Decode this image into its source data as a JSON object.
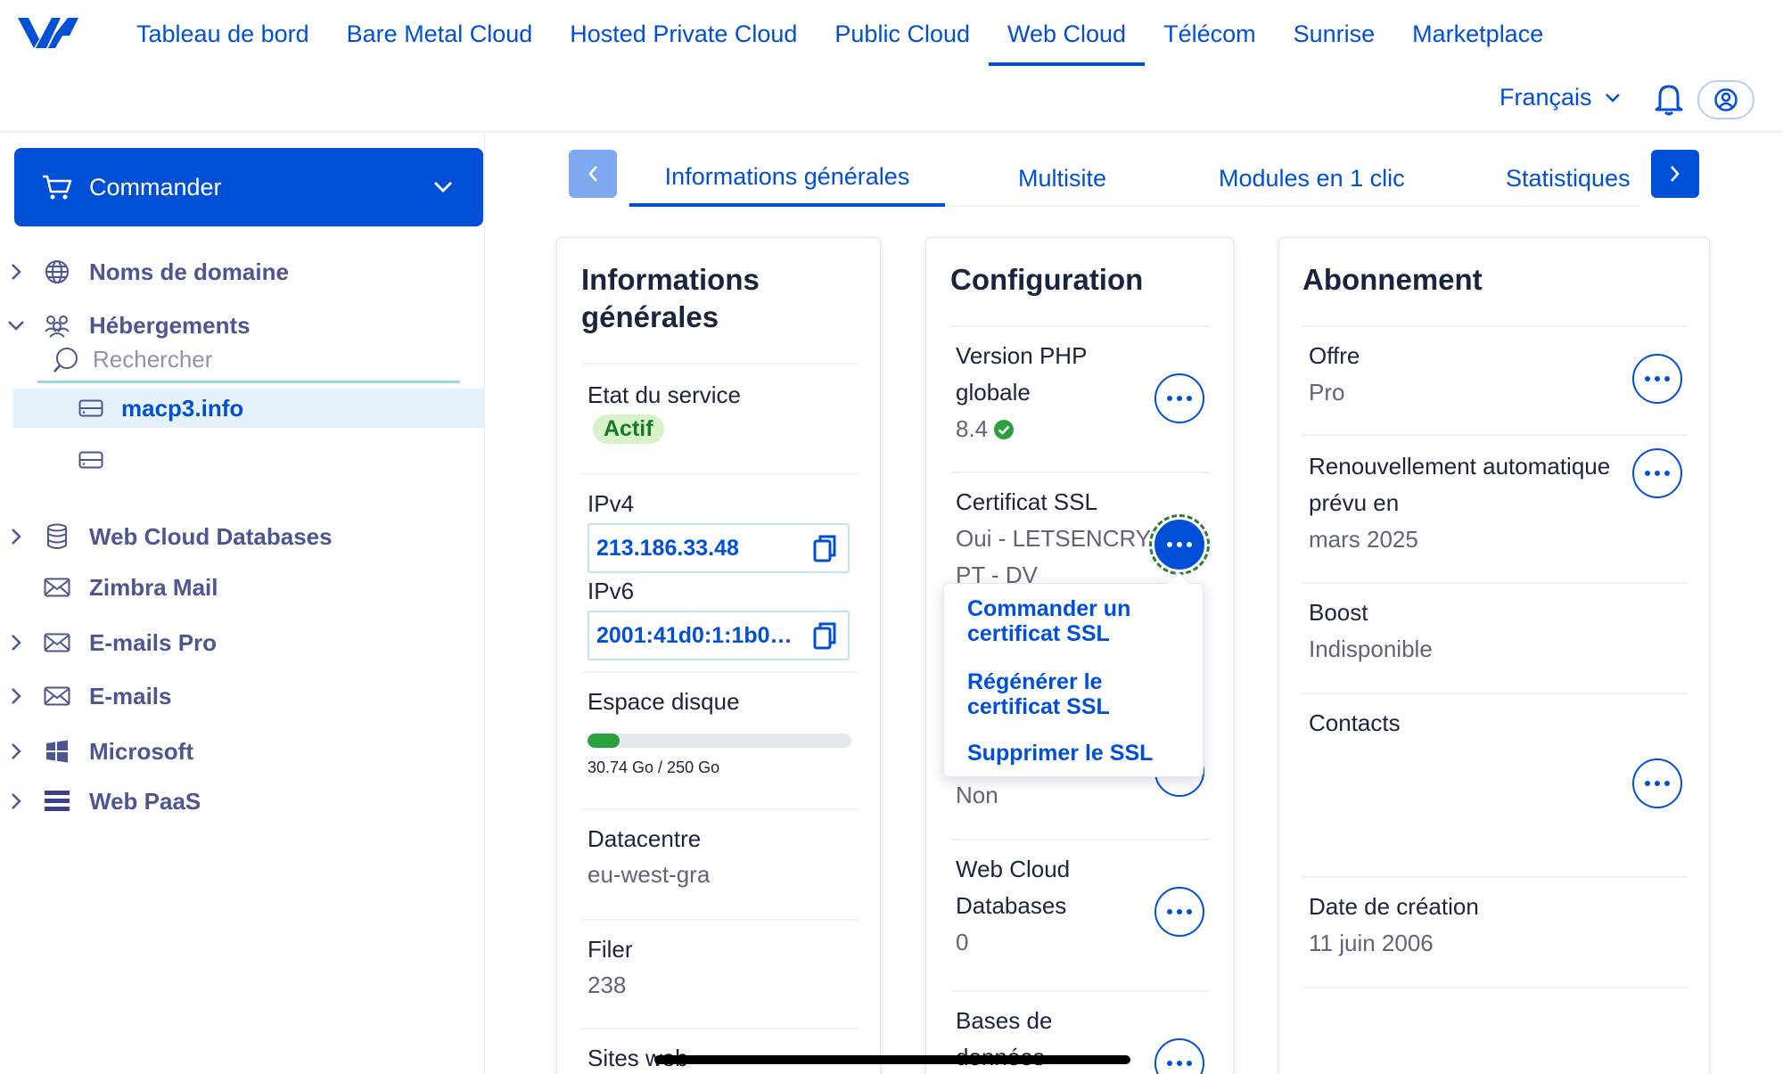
{
  "topnav": {
    "items": [
      {
        "label": "Tableau de bord"
      },
      {
        "label": "Bare Metal Cloud"
      },
      {
        "label": "Hosted Private Cloud"
      },
      {
        "label": "Public Cloud"
      },
      {
        "label": "Web Cloud",
        "active": true
      },
      {
        "label": "Télécom"
      },
      {
        "label": "Sunrise"
      },
      {
        "label": "Marketplace"
      }
    ],
    "language": "Français"
  },
  "sidebar": {
    "order_label": "Commander",
    "items": [
      {
        "label": "Noms de domaine",
        "icon": "globe-icon"
      },
      {
        "label": "Hébergements",
        "icon": "hosting-icon",
        "expanded": true
      },
      {
        "label": "Web Cloud Databases",
        "icon": "database-icon"
      },
      {
        "label": "Zimbra Mail",
        "icon": "mail-icon"
      },
      {
        "label": "E-mails Pro",
        "icon": "mail-icon"
      },
      {
        "label": "E-mails",
        "icon": "mail-icon"
      },
      {
        "label": "Microsoft",
        "icon": "windows-icon"
      },
      {
        "label": "Web PaaS",
        "icon": "paas-icon"
      }
    ],
    "search_placeholder": "Rechercher",
    "hostings": [
      {
        "label": "macp3.info",
        "active": true
      },
      {
        "label": ""
      }
    ]
  },
  "tabs": {
    "items": [
      {
        "label": "Informations générales",
        "active": true
      },
      {
        "label": "Multisite"
      },
      {
        "label": "Modules en 1 clic"
      },
      {
        "label": "Statistiques"
      }
    ]
  },
  "general": {
    "title": "Informations générales",
    "service_label": "Etat du service",
    "service_status": "Actif",
    "ipv4_label": "IPv4",
    "ipv4_value": "213.186.33.48",
    "ipv6_label": "IPv6",
    "ipv6_value": "2001:41d0:1:1b0…",
    "disk_label": "Espace disque",
    "disk_usage": "30.74 Go / 250 Go",
    "disk_used_fraction": 0.123,
    "datacentre_label": "Datacentre",
    "datacentre_value": "eu-west-gra",
    "filer_label": "Filer",
    "filer_value": "238",
    "sites_label": "Sites web"
  },
  "config": {
    "title": "Configuration",
    "php_label_1": "Version PHP",
    "php_label_2": "globale",
    "php_value": "8.4",
    "ssl_label": "Certificat SSL",
    "ssl_value_1": "Oui - LETSENCRY",
    "ssl_value_2": "PT - DV",
    "hidden_value": "Non",
    "wcdb_label_1": "Web Cloud",
    "wcdb_label_2": "Databases",
    "wcdb_value": "0",
    "db_label_1": "Bases de",
    "db_label_2": "données",
    "ssl_menu": {
      "order_1": "Commander un",
      "order_2": "certificat SSL",
      "regen_1": "Régénérer le",
      "regen_2": "certificat SSL",
      "delete": "Supprimer le SSL"
    }
  },
  "subscription": {
    "title": "Abonnement",
    "offer_label": "Offre",
    "offer_value": "Pro",
    "renewal_label_1": "Renouvellement automatique",
    "renewal_label_2": "prévu en",
    "renewal_value": "mars 2025",
    "boost_label": "Boost",
    "boost_value": "Indisponible",
    "contacts_label": "Contacts",
    "creation_label": "Date de création",
    "creation_value": "11 juin 2006"
  },
  "colors": {
    "brand": "#0050d7",
    "active_badge_bg": "#d8f3c9",
    "progress_fill": "#2aa13d"
  }
}
